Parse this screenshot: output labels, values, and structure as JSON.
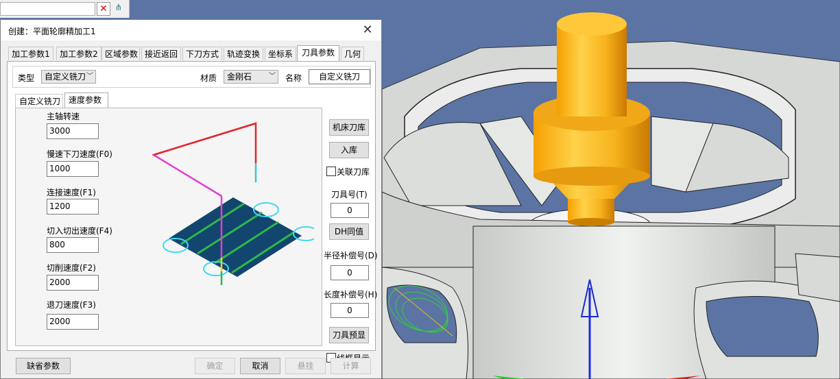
{
  "topbar": {
    "clear_icon": "close-x-icon",
    "tree_icon": "tree-icon"
  },
  "dialog": {
    "title": "创建：平面轮廓精加工1",
    "close_glyph": "✕",
    "tabs": [
      "加工参数1",
      "加工参数2",
      "区域参数",
      "接近返回",
      "下刀方式",
      "轨迹变换",
      "坐标系",
      "刀具参数",
      "几何"
    ],
    "active_tab": "刀具参数",
    "type_label": "类型",
    "type_value": "自定义铣刀",
    "material_label": "材质",
    "material_value": "金刚石",
    "name_label": "名称",
    "name_value": "自定义铣刀",
    "subtabs": [
      "自定义铣刀",
      "速度参数"
    ],
    "active_subtab": "速度参数",
    "speed": {
      "spindle_label": "主轴转速",
      "spindle_value": "3000",
      "slow_down_label": "慢速下刀速度(F0)",
      "slow_down_value": "1000",
      "link_label": "连接速度(F1)",
      "link_value": "1200",
      "inout_label": "切入切出速度(F4)",
      "inout_value": "800",
      "cut_label": "切削速度(F2)",
      "cut_value": "2000",
      "retract_label": "退刀速度(F3)",
      "retract_value": "2000"
    },
    "right": {
      "lib_button": "机床刀库",
      "store_button": "入库",
      "link_lib_label": "关联刀库",
      "tool_no_label": "刀具号(T)",
      "tool_no_value": "0",
      "dh_button": "DH同值",
      "radius_comp_label": "半径补偿号(D)",
      "radius_comp_value": "0",
      "length_comp_label": "长度补偿号(H)",
      "length_comp_value": "0",
      "preview_button": "刀具预显",
      "wireframe_label": "线框显示"
    },
    "footer": {
      "default_button": "缺省参数",
      "ok_button": "确定",
      "cancel_button": "取消",
      "suspend_button": "悬挂",
      "compute_button": "计算"
    }
  },
  "colors": {
    "viewport_bg": "#5b74a4",
    "tool_gold": "#f5a623",
    "part_gray": "#dcdedc",
    "path_fill": "#12466f",
    "path_green": "#2fb84a",
    "path_magenta": "#e040d0",
    "path_red": "#e02a2a",
    "path_cyan": "#40d8f0",
    "path_yellow": "#f0d020"
  }
}
